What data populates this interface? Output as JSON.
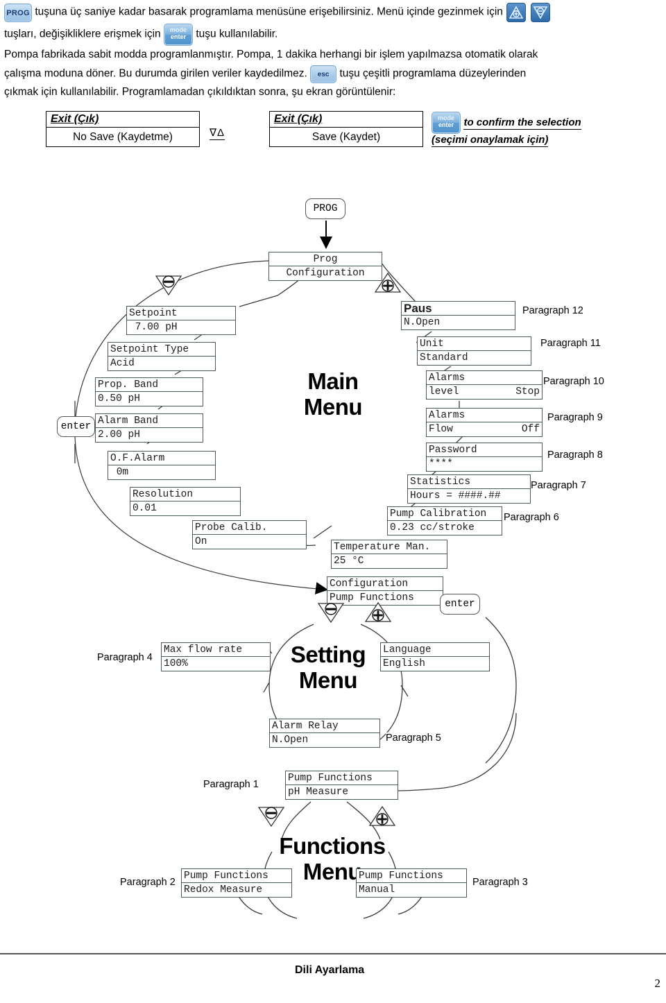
{
  "intro": {
    "seg1": "tuşuna üç saniye kadar basarak programlama menüsüne erişebilirsiniz. Menü içinde gezinmek için",
    "seg2": "tuşları, değişikliklere erişmek için",
    "seg3": "tuşu kullanılabilir.",
    "seg4": "Pompa fabrikada sabit modda programlanmıştır. Pompa, 1 dakika herhangi bir işlem yapılmazsa otomatik olarak",
    "seg5": "çalışma moduna döner. Bu durumda girilen veriler kaydedilmez.",
    "seg6": "tuşu çeşitli programlama düzeylerinden",
    "seg7": "çıkmak için kullanılabilir. Programlamadan çıkıldıktan sonra, şu ekran görüntülenir:"
  },
  "keys": {
    "prog": "PROG",
    "esc": "esc",
    "mode": "mode",
    "enter": "enter",
    "up_icon": "up-triangle-plus-icon",
    "down_icon": "down-triangle-minus-icon"
  },
  "exit_screens": {
    "left": {
      "title": "Exit (Çık)",
      "value": "No Save (Kaydetme)"
    },
    "right": {
      "title": "Exit (Çık)",
      "value": "Save (Kaydet)"
    },
    "nav_glyph": "∇Δ",
    "confirm_line1": "to confirm the selection",
    "confirm_line2": "(seçimi onaylamak için)"
  },
  "diagram": {
    "prog_button": "PROG",
    "enter_button_left": "enter",
    "enter_button_right": "enter",
    "menus": {
      "main": "Main\nMenu",
      "main_l1": "Main",
      "main_l2": "Menu",
      "setting_l1": "Setting",
      "setting_l2": "Menu",
      "functions_l1": "Functions",
      "functions_l2": "Menu"
    },
    "screens": {
      "prog_config": {
        "line1": "Prog",
        "line2": "Configuration",
        "right2": ""
      },
      "setpoint": {
        "line1": "Setpoint",
        "line2": " 7.00 pH",
        "right2": ""
      },
      "setpoint_type": {
        "line1": "Setpoint Type",
        "line2": "Acid",
        "right2": ""
      },
      "prop_band": {
        "line1": "Prop. Band",
        "line2": "0.50 pH",
        "right2": ""
      },
      "alarm_band": {
        "line1": "Alarm Band",
        "line2": "2.00 pH",
        "right2": ""
      },
      "of_alarm": {
        "line1": "O.F.Alarm",
        "line2": " 0m",
        "right2": ""
      },
      "resolution": {
        "line1": "Resolution",
        "line2": "0.01",
        "right2": ""
      },
      "probe_calib": {
        "line1": "Probe Calib.",
        "line2": "On",
        "right2": ""
      },
      "temperature_man": {
        "line1": "Temperature Man.",
        "line2": "25 °C",
        "right2": ""
      },
      "paus": {
        "line1": "Paus",
        "line2": "N.Open",
        "right2": ""
      },
      "unit": {
        "line1": "Unit",
        "line2": "Standard",
        "right2": ""
      },
      "alarms_level": {
        "line1": "Alarms",
        "line2": "level",
        "right2": "Stop"
      },
      "alarms_flow": {
        "line1": "Alarms",
        "line2": "Flow",
        "right2": "Off"
      },
      "password": {
        "line1": "Password",
        "line2": "****",
        "right2": ""
      },
      "statistics": {
        "line1": "Statistics",
        "line2": "Hours = ####.##",
        "right2": ""
      },
      "pump_calibration": {
        "line1": "Pump Calibration",
        "line2": "0.23 cc/stroke",
        "right2": ""
      },
      "configuration": {
        "line1": "Configuration",
        "line2": "Pump Functions",
        "right2": ""
      },
      "max_flow_rate": {
        "line1": "Max flow rate",
        "line2": "100%",
        "right2": ""
      },
      "language": {
        "line1": "Language",
        "line2": "English",
        "right2": ""
      },
      "alarm_relay": {
        "line1": "Alarm Relay",
        "line2": "N.Open",
        "right2": ""
      },
      "pump_ph": {
        "line1": "Pump Functions",
        "line2": "pH Measure",
        "right2": ""
      },
      "pump_redox": {
        "line1": "Pump Functions",
        "line2": "Redox Measure",
        "right2": ""
      },
      "pump_manual": {
        "line1": "Pump Functions",
        "line2": "Manual",
        "right2": ""
      }
    },
    "paragraph_labels": {
      "p12": "Paragraph 12",
      "p11": "Paragraph 11",
      "p10": "Paragraph 10",
      "p9": "Paragraph 9",
      "p8": "Paragraph 8",
      "p7": "Paragraph 7",
      "p6": "Paragraph 6",
      "p5": "Paragraph 5",
      "p4": "Paragraph 4",
      "p3": "Paragraph 3",
      "p2": "Paragraph 2",
      "p1": "Paragraph 1"
    }
  },
  "footer": {
    "caption": "Dili Ayarlama",
    "page_number": "2"
  },
  "colors": {
    "lcd_border": "#4a5a5a",
    "key_blue": "#1a3c73",
    "key_fill": "#a9cbe9",
    "arrow_key": "#2e6ba8"
  }
}
